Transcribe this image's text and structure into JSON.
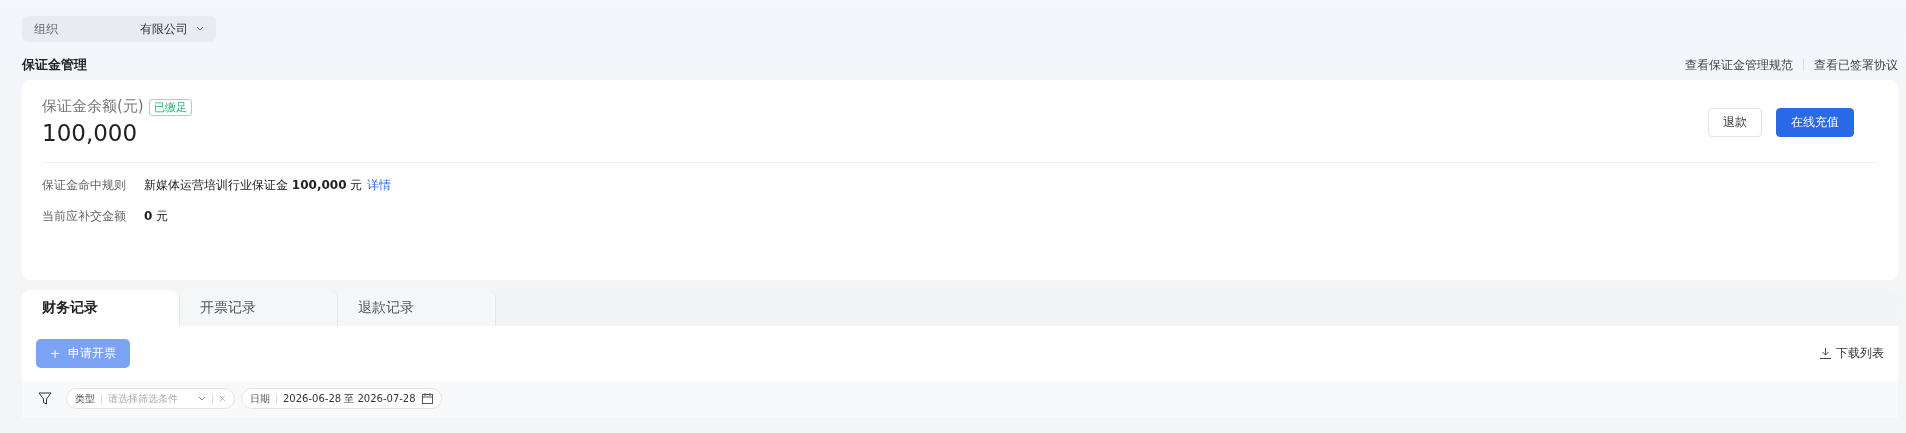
{
  "org_selector": {
    "label": "组织",
    "value": "有限公司"
  },
  "page_title": "保证金管理",
  "header_links": [
    "查看保证金管理规范",
    "查看已签署协议"
  ],
  "balance": {
    "label": "保证金余额(元)",
    "badge": "已缴足",
    "amount": "100,000"
  },
  "actions": [
    {
      "label": "退款",
      "kind": "secondary"
    },
    {
      "label": "在线充值",
      "kind": "primary"
    }
  ],
  "info_rows": [
    {
      "label": "保证金命中规则",
      "text": "新媒体运营培训行业保证金 **100,000** 元",
      "link": "详情"
    },
    {
      "label": "当前应补交金额",
      "text": "**0** 元"
    }
  ],
  "tabs": [
    {
      "label": "财务记录",
      "selected": true
    },
    {
      "label": "开票记录",
      "selected": false
    },
    {
      "label": "退款记录",
      "selected": false
    }
  ],
  "apply_button": {
    "icon": "+",
    "label": "申请开票",
    "disabled": true
  },
  "download": "下载列表",
  "filters": [
    {
      "kind": "select",
      "label": "类型",
      "placeholder": "请选择筛选条件"
    },
    {
      "kind": "date",
      "label": "日期",
      "value": "2026-06-28 至 2026-07-28"
    }
  ]
}
